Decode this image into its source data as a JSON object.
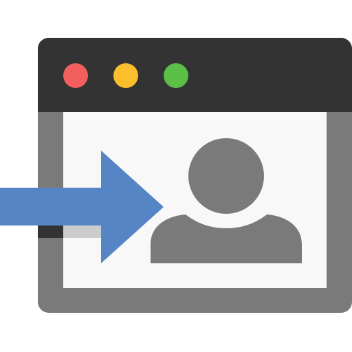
{
  "icon": {
    "name": "user-login-window-icon",
    "colors": {
      "window_frame": "#7a7a7a",
      "title_bar": "#333333",
      "content_background": "#f8f8f8",
      "close_dot": "#f25f5c",
      "minimize_dot": "#fbbf2e",
      "maximize_dot": "#5cbf48",
      "user_silhouette": "#7a7a7a",
      "arrow": "#5585c5",
      "arrow_shadow_dark": "#333333",
      "arrow_shadow_light": "#cccccc"
    },
    "parts": [
      "window-frame",
      "title-bar",
      "close-dot",
      "minimize-dot",
      "maximize-dot",
      "content-area",
      "user-avatar-icon",
      "enter-arrow-icon"
    ]
  }
}
